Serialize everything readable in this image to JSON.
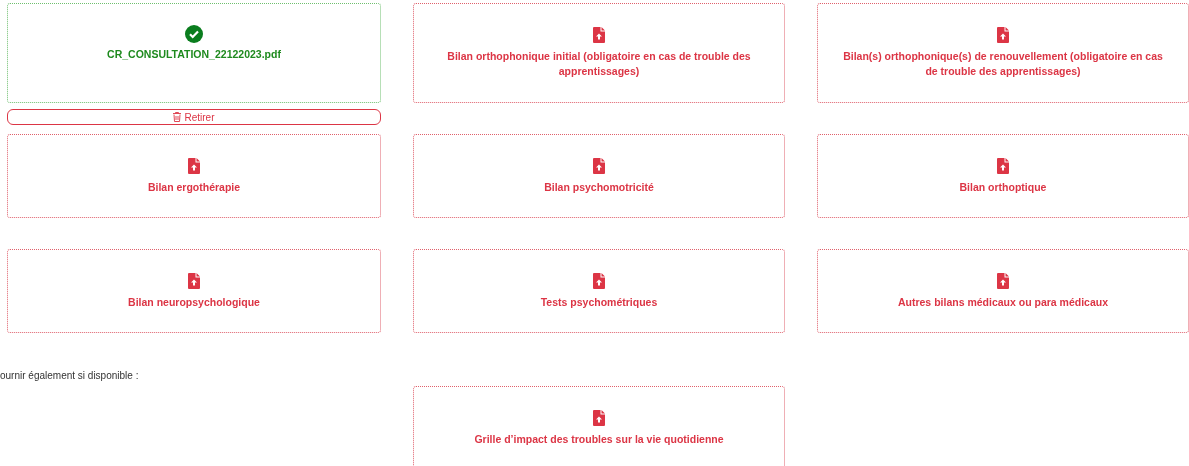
{
  "documents": [
    {
      "kind": "uploaded",
      "label": "CR_CONSULTATION_22122023.pdf",
      "remove_button": "Retirer"
    },
    {
      "kind": "upload",
      "label": "Bilan orthophonique initial (obligatoire en cas de trouble des apprentissages)"
    },
    {
      "kind": "upload",
      "label": "Bilan(s) orthophonique(s) de renouvellement (obligatoire en cas de trouble des apprentissages)"
    },
    {
      "kind": "upload",
      "label": "Bilan ergothérapie"
    },
    {
      "kind": "upload",
      "label": "Bilan psychomotricité"
    },
    {
      "kind": "upload",
      "label": "Bilan orthoptique"
    },
    {
      "kind": "upload",
      "label": "Bilan neuropsychologique"
    },
    {
      "kind": "upload",
      "label": "Tests psychométriques"
    },
    {
      "kind": "upload",
      "label": "Autres bilans médicaux ou para médicaux"
    }
  ],
  "optional_note": "ournir également si disponible :",
  "optional_documents": [
    {
      "kind": "upload",
      "label": "Grille d’impact des troubles sur la vie quotidienne"
    }
  ]
}
